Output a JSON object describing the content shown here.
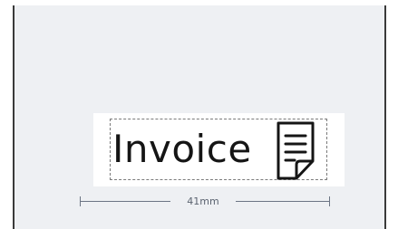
{
  "label": {
    "text": "Invoice",
    "icon": "document-icon"
  },
  "dimension": {
    "width_label": "41mm"
  },
  "colors": {
    "canvas_background": "#eef0f3",
    "label_background": "#ffffff",
    "text": "#151515",
    "guide": "#6c7584"
  }
}
